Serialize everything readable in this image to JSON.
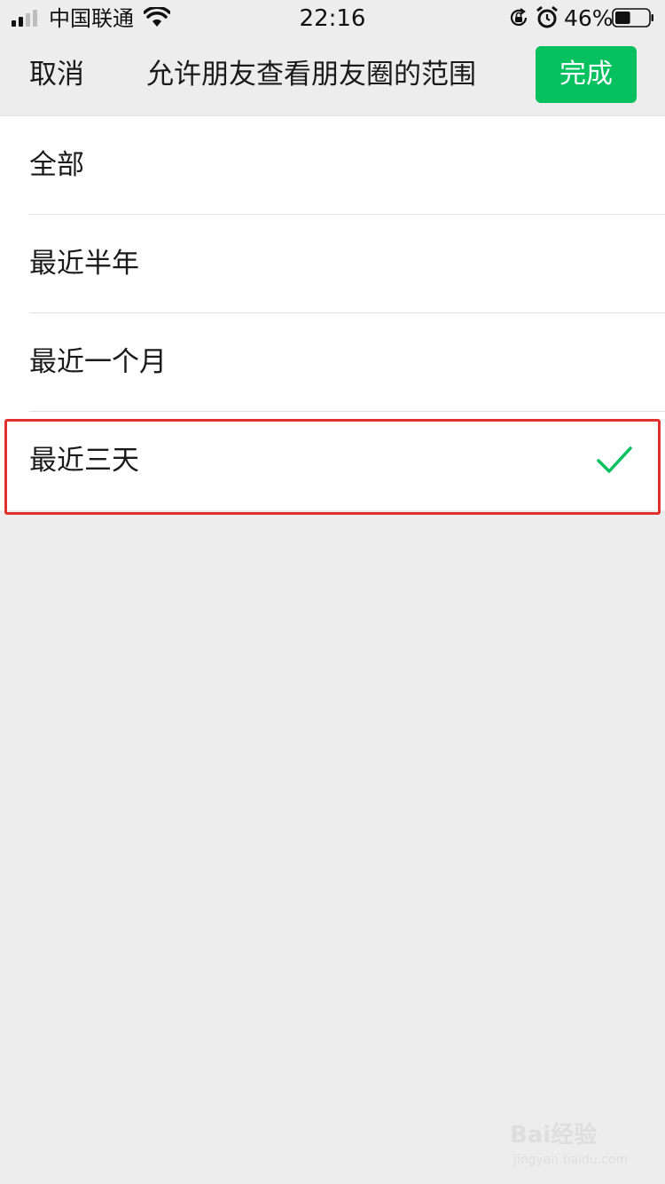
{
  "status_bar": {
    "carrier": "中国联通",
    "time": "22:16",
    "battery_percent": "46%",
    "battery_level": 0.46,
    "signal_bars": 2,
    "icons": [
      "signal-icon",
      "wifi-icon",
      "rotation-lock-icon",
      "alarm-icon",
      "battery-icon"
    ]
  },
  "nav": {
    "cancel_label": "取消",
    "title": "允许朋友查看朋友圈的范围",
    "done_label": "完成"
  },
  "options": [
    {
      "label": "全部",
      "selected": false
    },
    {
      "label": "最近半年",
      "selected": false
    },
    {
      "label": "最近一个月",
      "selected": false
    },
    {
      "label": "最近三天",
      "selected": true
    }
  ],
  "watermark": {
    "main": "Bai经验",
    "sub": "jingyan.baidu.com"
  },
  "colors": {
    "accent": "#07c160",
    "background": "#ededed",
    "highlight": "#e0322d"
  }
}
